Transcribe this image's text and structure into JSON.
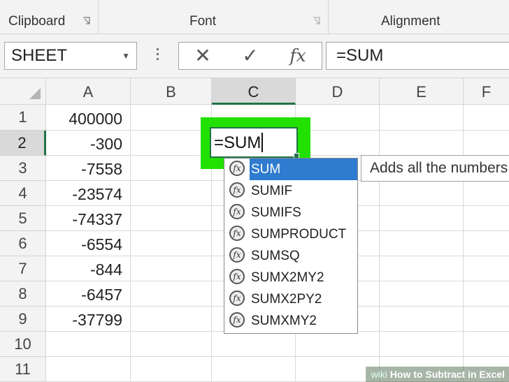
{
  "ribbon": {
    "groups": [
      {
        "label": "Clipboard"
      },
      {
        "label": "Font"
      },
      {
        "label": "Alignment"
      }
    ]
  },
  "formula_bar": {
    "name_box": "SHEET",
    "cancel_icon": "✕",
    "enter_icon": "✓",
    "fx_label": "fx",
    "formula": "=SUM"
  },
  "columns": [
    "A",
    "B",
    "C",
    "D",
    "E",
    "F"
  ],
  "selected_column": "C",
  "rows": [
    {
      "num": "1",
      "a": "400000"
    },
    {
      "num": "2",
      "a": "-300"
    },
    {
      "num": "3",
      "a": "-7558"
    },
    {
      "num": "4",
      "a": "-23574"
    },
    {
      "num": "5",
      "a": "-74337"
    },
    {
      "num": "6",
      "a": "-6554"
    },
    {
      "num": "7",
      "a": "-844"
    },
    {
      "num": "8",
      "a": "-6457"
    },
    {
      "num": "9",
      "a": "-37799"
    },
    {
      "num": "10",
      "a": ""
    },
    {
      "num": "11",
      "a": ""
    }
  ],
  "selected_row": "2",
  "active_cell": {
    "value": "=SUM"
  },
  "autocomplete": {
    "items": [
      "SUM",
      "SUMIF",
      "SUMIFS",
      "SUMPRODUCT",
      "SUMSQ",
      "SUMX2MY2",
      "SUMX2PY2",
      "SUMXMY2"
    ],
    "selected_index": 0,
    "tooltip": "Adds all the numbers"
  },
  "watermark": {
    "prefix": "wiki",
    "text": "How to Subtract in Excel"
  },
  "colors": {
    "accent": "#217346",
    "highlight": "#22e000",
    "selection": "#2e7bcf"
  }
}
